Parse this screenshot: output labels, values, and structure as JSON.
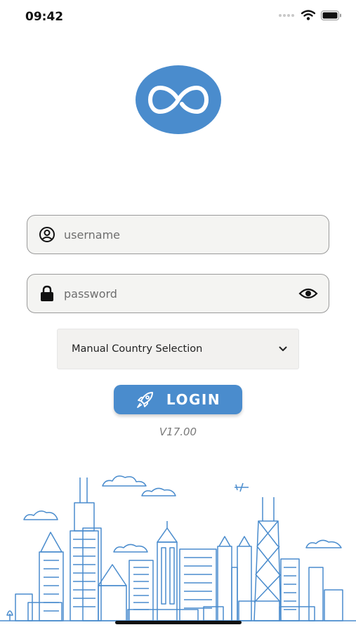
{
  "status_bar": {
    "time": "09:42",
    "icons": [
      "signal-icon",
      "wifi-icon",
      "battery-icon"
    ]
  },
  "logo": {
    "icon": "infinity-icon",
    "color": "#4a8ccd"
  },
  "form": {
    "username": {
      "placeholder": "username",
      "value": "",
      "icon": "user-circle-icon"
    },
    "password": {
      "placeholder": "password",
      "value": "",
      "icon": "lock-icon",
      "toggle_icon": "eye-icon"
    },
    "country_select": {
      "selected": "Manual Country Selection",
      "icon": "chevron-down-icon"
    },
    "login_button": {
      "label": "LOGIN",
      "icon": "rocket-icon"
    }
  },
  "version": "V17.00",
  "illustration": {
    "name": "city-skyline",
    "color": "#4a8ccd"
  },
  "colors": {
    "accent": "#4a8ccd",
    "field_bg": "#f4f4f2",
    "field_border": "#9a9a9a"
  }
}
